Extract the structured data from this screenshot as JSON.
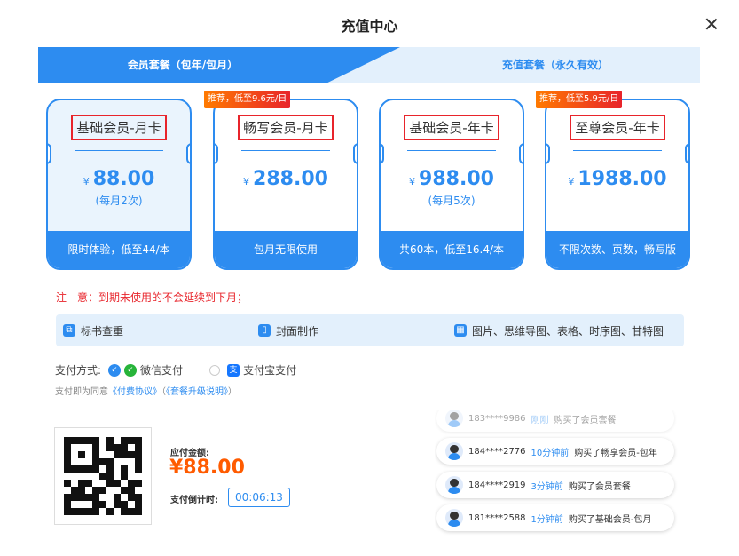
{
  "dialog": {
    "title": "充值中心"
  },
  "tabs": [
    {
      "label": "会员套餐（包年/包月）",
      "active": true
    },
    {
      "label": "充值套餐（永久有效）",
      "active": false
    }
  ],
  "plans": [
    {
      "name": "基础会员-月卡",
      "currency": "¥",
      "price": "88.00",
      "sub": "(每月2次)",
      "footer": "限时体验，低至44/本",
      "badge": ""
    },
    {
      "name": "畅写会员-月卡",
      "currency": "¥",
      "price": "288.00",
      "sub": "",
      "footer": "包月无限使用",
      "badge": "推荐，低至9.6元/日"
    },
    {
      "name": "基础会员-年卡",
      "currency": "¥",
      "price": "988.00",
      "sub": "(每月5次)",
      "footer": "共60本，低至16.4/本",
      "badge": ""
    },
    {
      "name": "至尊会员-年卡",
      "currency": "¥",
      "price": "1988.00",
      "sub": "",
      "footer": "不限次数、页数，畅写版",
      "badge": "推荐，低至5.9元/日"
    }
  ],
  "note": "注　意：到期未使用的不会延续到下月；",
  "features": [
    {
      "label": "标书查重",
      "icon": "copy-icon"
    },
    {
      "label": "封面制作",
      "icon": "cover-icon"
    },
    {
      "label": "图片、思维导图、表格、时序图、甘特图",
      "icon": "grid-icon"
    }
  ],
  "payment": {
    "label": "支付方式:",
    "wechat": "微信支付",
    "alipay": "支付宝支付",
    "agree_prefix": "支付即为同意",
    "agreement1": "《付费协议》",
    "agreement2": "《套餐升级说明》",
    "amount_label": "应付金额:",
    "amount": "¥88.00",
    "countdown_label": "支付倒计时:",
    "countdown": "00:06:13"
  },
  "feed": [
    {
      "user": "183****9986",
      "time": "刚刚",
      "action": "购买了会员套餐"
    },
    {
      "user": "184****2776",
      "time": "10分钟前",
      "action": "购买了畅享会员-包年"
    },
    {
      "user": "184****2919",
      "time": "3分钟前",
      "action": "购买了会员套餐"
    },
    {
      "user": "181****2588",
      "time": "1分钟前",
      "action": "购买了基础会员-包月"
    }
  ],
  "colors": {
    "accent": "#2d8cf0",
    "warning": "#e8242b",
    "price": "#ff5b00"
  }
}
